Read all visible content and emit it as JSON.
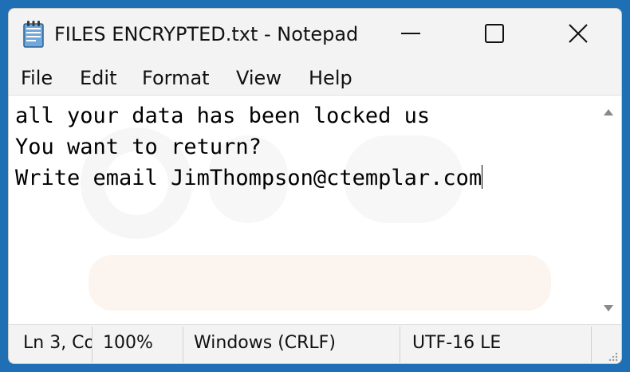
{
  "window": {
    "title": "FILES ENCRYPTED.txt - Notepad"
  },
  "menu": {
    "items": [
      "File",
      "Edit",
      "Format",
      "View",
      "Help"
    ]
  },
  "editor": {
    "lines": [
      "all your data has been locked us",
      "You want to return?",
      "Write email JimThompson@ctemplar.com"
    ]
  },
  "status": {
    "position": "Ln 3, Co",
    "zoom": "100%",
    "line_ending": "Windows (CRLF)",
    "encoding": "UTF-16 LE"
  },
  "icons": {
    "app": "notepad-icon",
    "minimize": "minimize-icon",
    "maximize": "maximize-icon",
    "close": "close-icon",
    "scroll_up": "scroll-up-arrow-icon",
    "scroll_down": "scroll-down-arrow-icon",
    "resize": "resize-grip-icon"
  },
  "colors": {
    "background": "#1f6fb5",
    "chrome": "#f3f3f3",
    "editor": "#ffffff"
  }
}
